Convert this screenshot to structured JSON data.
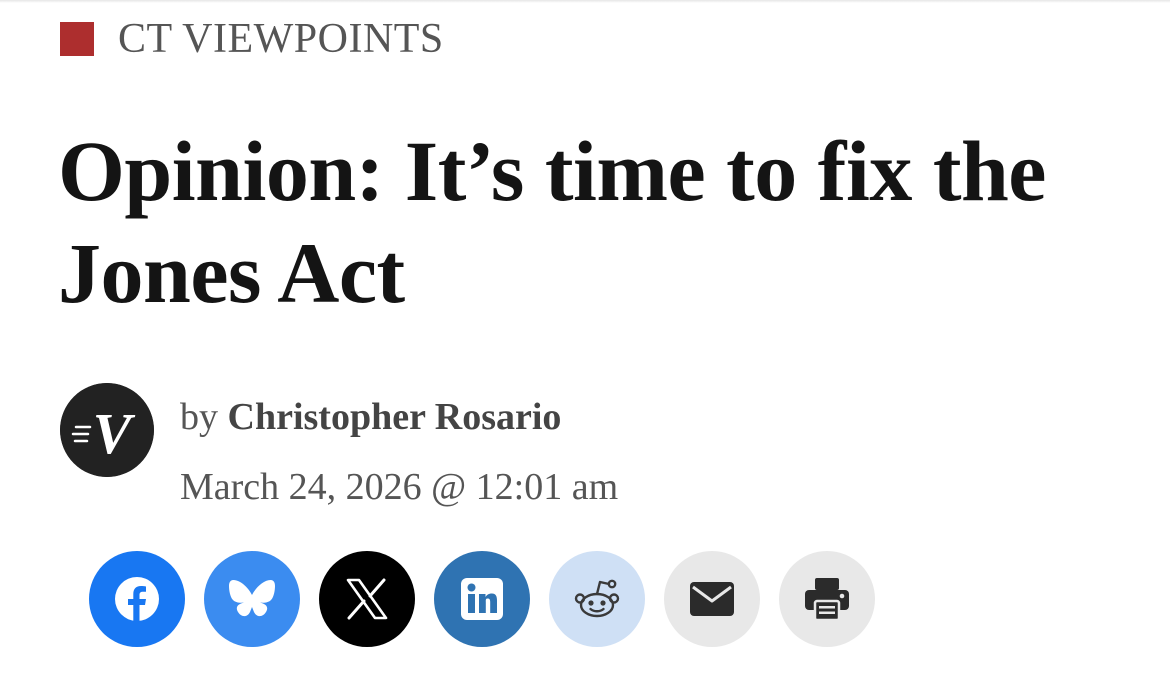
{
  "section": {
    "label": "CT VIEWPOINTS",
    "accent_color": "#ad2e2e"
  },
  "article": {
    "title": "Opinion: It’s time to fix the Jones Act",
    "byline_prefix": "by",
    "author": "Christopher Rosario",
    "date": "March 24, 2026 @ 12:01 am",
    "avatar_letter": "V"
  },
  "share": [
    {
      "network": "facebook",
      "icon": "facebook-icon",
      "color": "#1877f2"
    },
    {
      "network": "bluesky",
      "icon": "bluesky-butterfly-icon",
      "color": "#3b8cf0"
    },
    {
      "network": "x",
      "icon": "x-logo-icon",
      "color": "#000000"
    },
    {
      "network": "linkedin",
      "icon": "linkedin-icon",
      "color": "#2f73b2"
    },
    {
      "network": "reddit",
      "icon": "reddit-alien-icon",
      "color": "#cfe0f5"
    },
    {
      "network": "email",
      "icon": "envelope-icon",
      "color": "#e8e8e8"
    },
    {
      "network": "print",
      "icon": "printer-icon",
      "color": "#e8e8e8"
    }
  ]
}
